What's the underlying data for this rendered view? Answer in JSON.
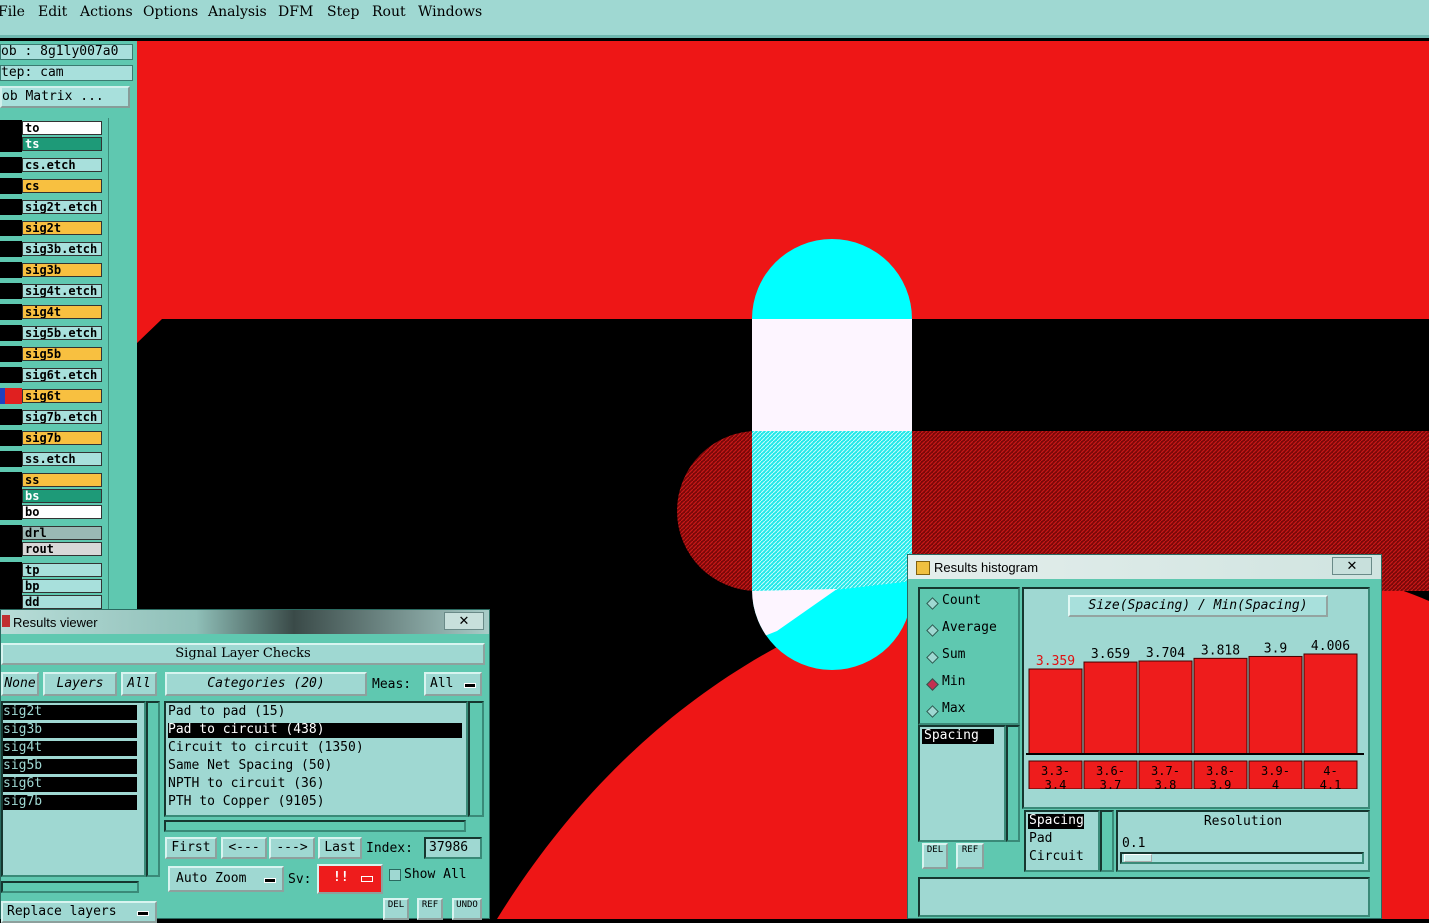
{
  "menu": [
    "File",
    "Edit",
    "Actions",
    "Options",
    "Analysis",
    "DFM",
    "Step",
    "Rout",
    "Windows"
  ],
  "job": {
    "job_line": "ob : 8g1ly007a0",
    "step_line": "tep: cam",
    "matrix_label": "ob Matrix ..."
  },
  "layers": [
    {
      "name": "to",
      "bg": "#ffffff",
      "fg": "#000000"
    },
    {
      "name": "ts",
      "bg": "#1e9a78",
      "fg": "#ffffff"
    },
    {
      "name": "cs.etch",
      "bg": "#a8e0dc",
      "fg": "#000000"
    },
    {
      "name": "cs",
      "bg": "#f8c040",
      "fg": "#000000"
    },
    {
      "name": "sig2t.etch",
      "bg": "#a8e0dc",
      "fg": "#000000"
    },
    {
      "name": "sig2t",
      "bg": "#f8c040",
      "fg": "#000000"
    },
    {
      "name": "sig3b.etch",
      "bg": "#a8e0dc",
      "fg": "#000000"
    },
    {
      "name": "sig3b",
      "bg": "#f8c040",
      "fg": "#000000"
    },
    {
      "name": "sig4t.etch",
      "bg": "#a8e0dc",
      "fg": "#000000"
    },
    {
      "name": "sig4t",
      "bg": "#f8c040",
      "fg": "#000000"
    },
    {
      "name": "sig5b.etch",
      "bg": "#a8e0dc",
      "fg": "#000000"
    },
    {
      "name": "sig5b",
      "bg": "#f8c040",
      "fg": "#000000"
    },
    {
      "name": "sig6t.etch",
      "bg": "#a8e0dc",
      "fg": "#000000"
    },
    {
      "name": "sig6t",
      "bg": "#f8c040",
      "fg": "#000000"
    },
    {
      "name": "sig7b.etch",
      "bg": "#a8e0dc",
      "fg": "#000000"
    },
    {
      "name": "sig7b",
      "bg": "#f8c040",
      "fg": "#000000"
    },
    {
      "name": "ss.etch",
      "bg": "#a8e0dc",
      "fg": "#000000"
    },
    {
      "name": "ss",
      "bg": "#f8c040",
      "fg": "#000000"
    },
    {
      "name": "bs",
      "bg": "#1e9a78",
      "fg": "#ffffff"
    },
    {
      "name": "bo",
      "bg": "#ffffff",
      "fg": "#000000"
    },
    {
      "name": "drl",
      "bg": "#9ab8b4",
      "fg": "#000000"
    },
    {
      "name": "rout",
      "bg": "#d8d8d8",
      "fg": "#000000"
    },
    {
      "name": "tp",
      "bg": "#a8e0dc",
      "fg": "#000000"
    },
    {
      "name": "bp",
      "bg": "#a8e0dc",
      "fg": "#000000"
    },
    {
      "name": "dd",
      "bg": "#a8e0dc",
      "fg": "#000000"
    }
  ],
  "results_viewer": {
    "title": "Results viewer",
    "close": "✕",
    "heading": "Signal Layer Checks",
    "none_btn": "None",
    "layers_btn": "Layers",
    "all_btn": "All",
    "layer_list": [
      "sig2t",
      "sig3b",
      "sig4t",
      "sig5b",
      "sig6t",
      "sig7b"
    ],
    "categories_btn": "Categories (20)",
    "meas_label": "Meas:",
    "meas_value": "All",
    "categories": [
      "Pad to pad (15)",
      "Pad to circuit (438)",
      "Circuit to circuit (1350)",
      "Same Net Spacing (50)",
      "NPTH to circuit (36)",
      "PTH to Copper (9105)"
    ],
    "selected_category": 1,
    "first_btn": "First",
    "prev_btn": "<---",
    "next_btn": "--->",
    "last_btn": "Last",
    "index_label": "Index:",
    "index_value": "37986",
    "autozoom_btn": "Auto Zoom",
    "sv_label": "Sv:",
    "sv_value": "!!",
    "showall_label": "Show All",
    "replace_btn": "Replace layers",
    "del_label": "DEL",
    "ref_label": "REF",
    "undo_label": "UNDO"
  },
  "histogram": {
    "title": "Results histogram",
    "close": "✕",
    "header": "Size(Spacing) / Min(Spacing)",
    "radios": [
      "Count",
      "Average",
      "Sum",
      "Min",
      "Max"
    ],
    "selected_radio": 3,
    "measure_list": [
      "Spacing"
    ],
    "resolution_list": [
      "Spacing",
      "Pad",
      "Circuit"
    ],
    "resolution_label": "Resolution",
    "resolution_value": "0.1",
    "del_label": "DEL",
    "ref_label": "REF"
  },
  "chart_data": {
    "type": "bar",
    "categories": [
      "3.3-3.4",
      "3.6-3.7",
      "3.7-3.8",
      "3.8-3.9",
      "3.9-4",
      "4-4.1"
    ],
    "category_labels": [
      [
        "3.3-",
        "3.4"
      ],
      [
        "3.6-",
        "3.7"
      ],
      [
        "3.7-",
        "3.8"
      ],
      [
        "3.8-",
        "3.9"
      ],
      [
        "3.9-",
        "4"
      ],
      [
        "4-",
        "4.1"
      ]
    ],
    "values": [
      3.359,
      3.659,
      3.704,
      3.818,
      3.9,
      4.006
    ],
    "value_labels": [
      "3.359",
      "3.659",
      "3.704",
      "3.818",
      "3.9",
      "4.006"
    ],
    "title": "Size(Spacing) / Min(Spacing)",
    "highlight_index": 0,
    "bar_color": "#ee1c1c",
    "highlight_label_color": "#e01010"
  }
}
